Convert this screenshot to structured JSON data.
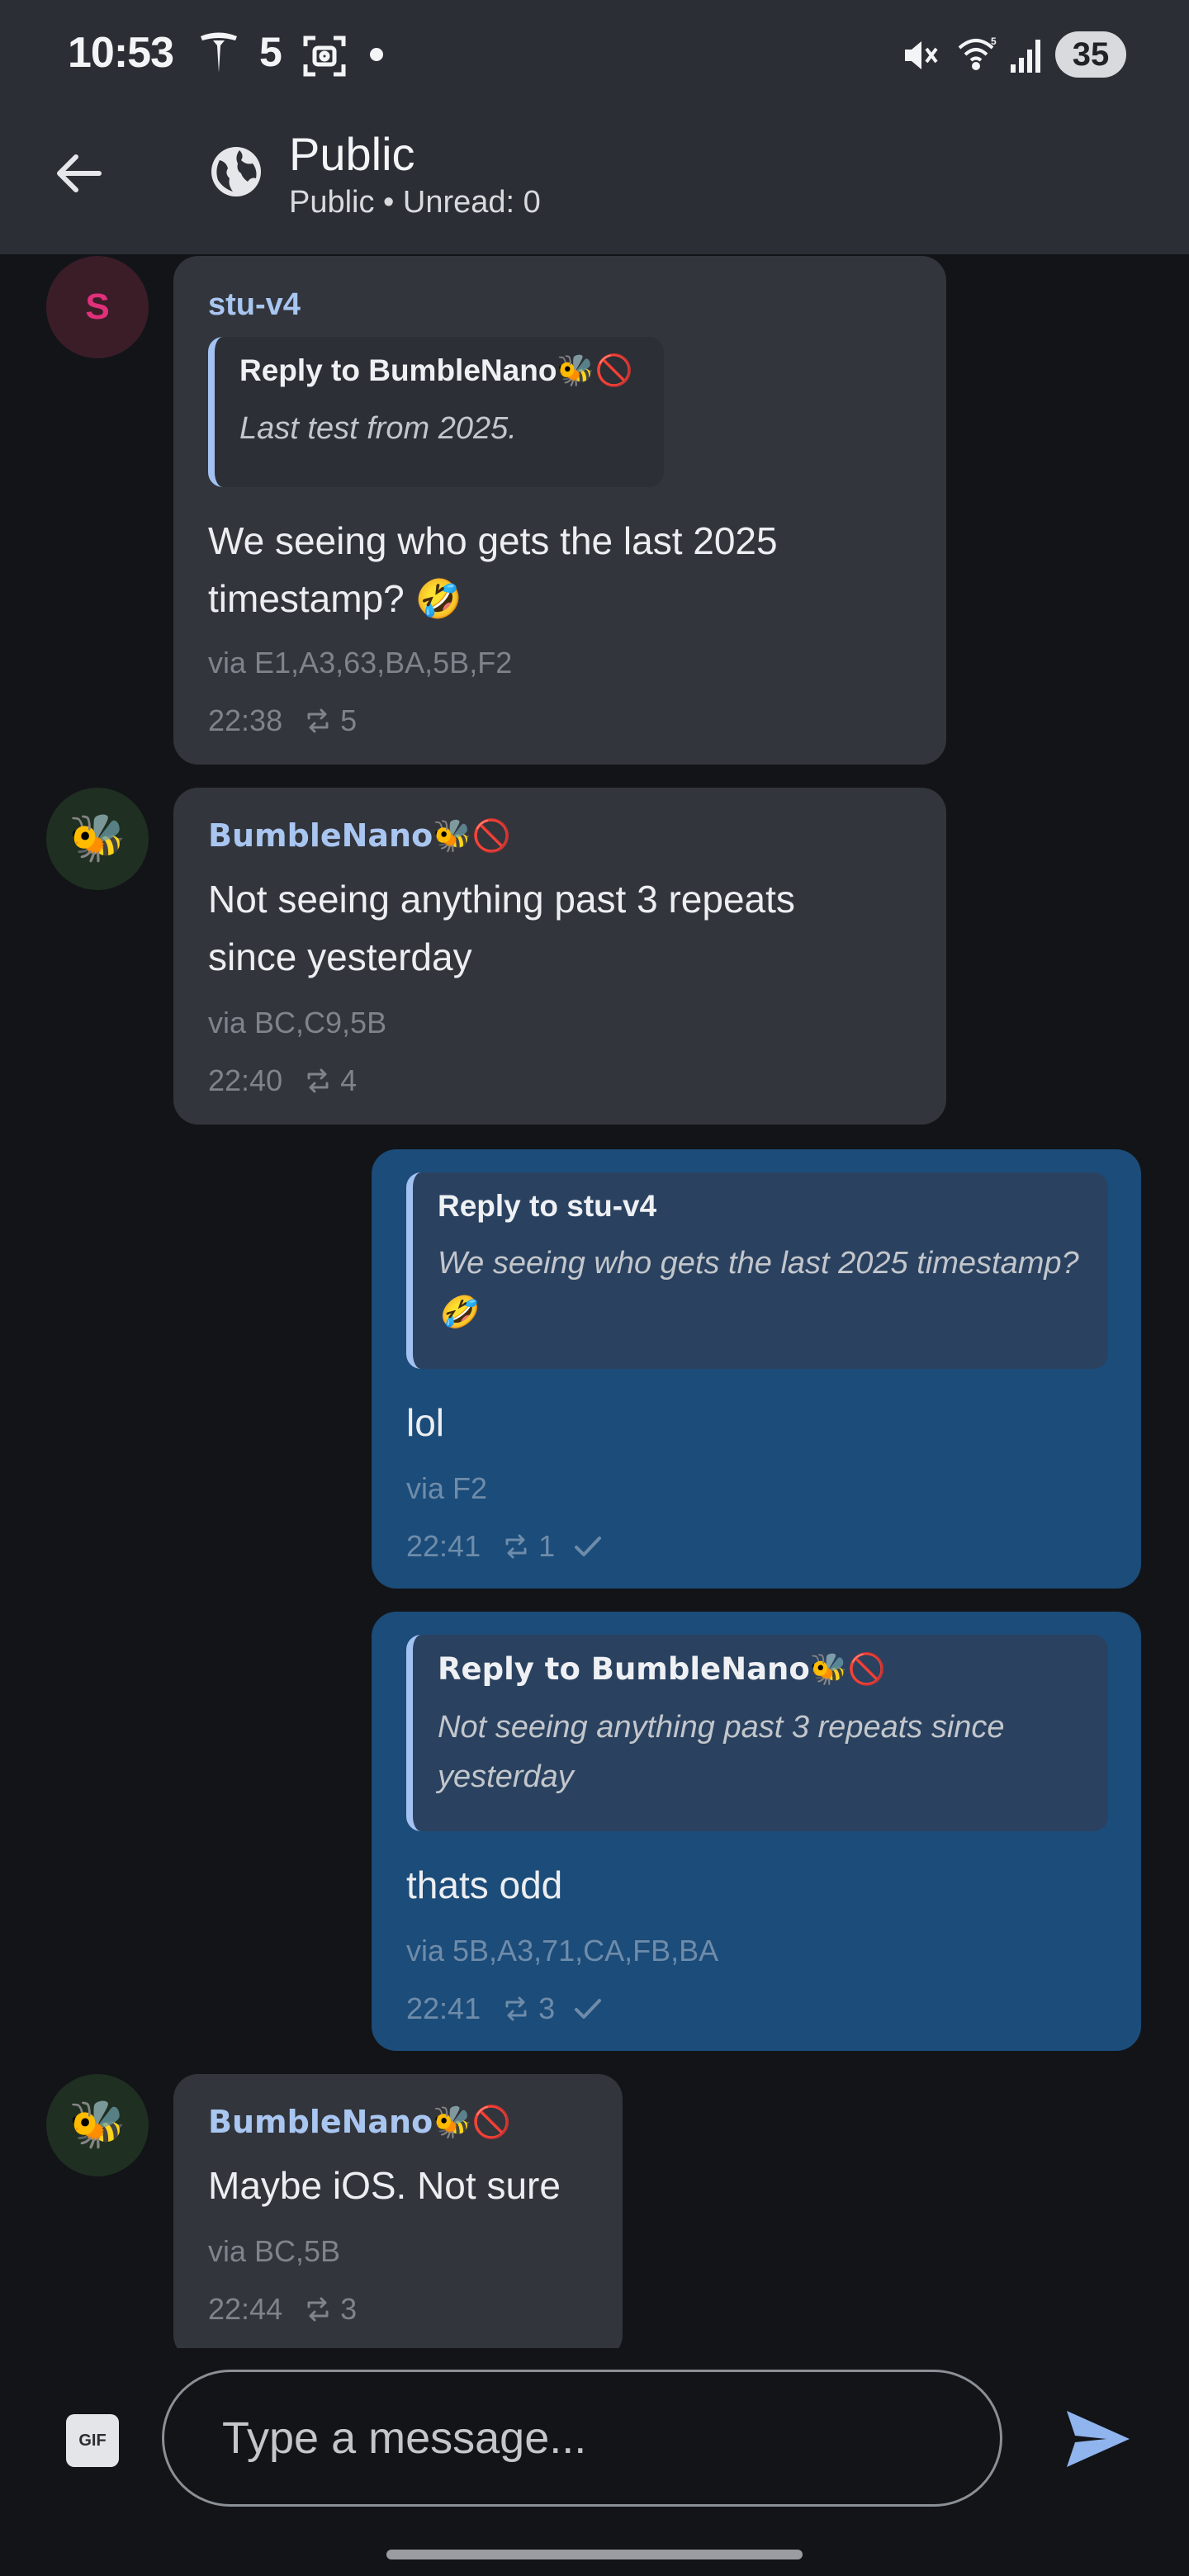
{
  "status_bar": {
    "time": "10:53",
    "notification_count": "5",
    "battery": "35"
  },
  "app_bar": {
    "title": "Public",
    "subtitle": "Public • Unread: 0"
  },
  "messages": [
    {
      "sender": "stu-v4",
      "avatar_initial": "S",
      "reply_title": "Reply to BumbleNano🐝🚫",
      "reply_text": "Last test from 2025.",
      "body": "We seeing who gets the last 2025 timestamp? 🤣",
      "via": "via E1,A3,63,BA,5B,F2",
      "time": "22:38",
      "repeats": "5"
    },
    {
      "sender": "BumbleNano🐝🚫",
      "avatar_emoji": "🐝",
      "body": "Not seeing anything past 3 repeats since yesterday",
      "via": "via BC,C9,5B",
      "time": "22:40",
      "repeats": "4"
    },
    {
      "reply_title": "Reply to stu-v4",
      "reply_text": "We seeing who gets the last 2025 timestamp? 🤣",
      "body": "lol",
      "via": "via F2",
      "time": "22:41",
      "repeats": "1"
    },
    {
      "reply_title": "Reply to BumbleNano🐝🚫",
      "reply_text": "Not seeing anything past 3 repeats since yesterday",
      "body": "thats odd",
      "via": "via 5B,A3,71,CA,FB,BA",
      "time": "22:41",
      "repeats": "3"
    },
    {
      "sender": "BumbleNano🐝🚫",
      "avatar_emoji": "🐝",
      "body": "Maybe iOS. Not sure",
      "via": "via BC,5B",
      "time": "22:44",
      "repeats": "3"
    }
  ],
  "composer": {
    "gif_label": "GIF",
    "placeholder": "Type a message..."
  },
  "icons": {
    "back": "arrow-back-icon",
    "channel": "globe-icon",
    "repeat": "repeat-icon",
    "delivered": "check-icon",
    "send": "send-icon"
  },
  "colors": {
    "app_bar": "#2b2f35",
    "background": "#121418",
    "incoming_bubble": "#32353b",
    "outgoing_bubble": "#1c4c79",
    "sender_name": "#a9c6f1",
    "send_accent": "#8fb4ee"
  }
}
